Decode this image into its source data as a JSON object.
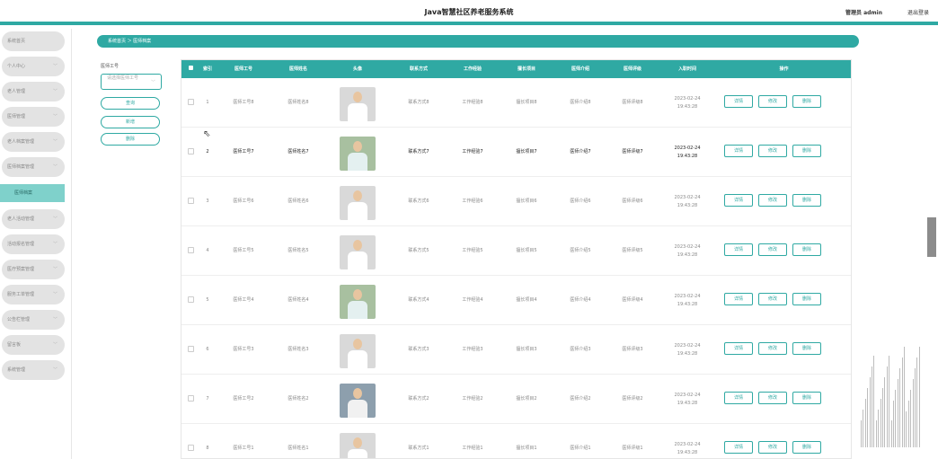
{
  "header": {
    "title": "Java智慧社区养老服务系统",
    "user": "管理员 admin",
    "logout": "退出登录"
  },
  "sidebar": {
    "items": [
      {
        "label": "系统首页",
        "has_chevron": false
      },
      {
        "label": "个人中心",
        "has_chevron": true
      },
      {
        "label": "老人管理",
        "has_chevron": true
      },
      {
        "label": "医师管理",
        "has_chevron": true
      },
      {
        "label": "老人档案管理",
        "has_chevron": true
      },
      {
        "label": "医师档案管理",
        "has_chevron": true
      },
      {
        "label": "老人活动管理",
        "has_chevron": true
      },
      {
        "label": "活动报名管理",
        "has_chevron": true
      },
      {
        "label": "医疗预案管理",
        "has_chevron": true
      },
      {
        "label": "服务工单管理",
        "has_chevron": true
      },
      {
        "label": "公告栏管理",
        "has_chevron": true
      },
      {
        "label": "留言板",
        "has_chevron": true
      },
      {
        "label": "系统管理",
        "has_chevron": true
      }
    ],
    "active_sub": "医师档案"
  },
  "breadcrumb": "系统首页 ＞ 医师档案",
  "search": {
    "label": "医师工号",
    "placeholder": "请选择医师工号",
    "query": "查询",
    "add": "新增",
    "delete": "删除"
  },
  "table": {
    "columns": [
      "",
      "索引",
      "医师工号",
      "医师姓名",
      "头像",
      "联系方式",
      "工作经验",
      "擅长项目",
      "医师介绍",
      "医师评级",
      "入职时间",
      "操作"
    ],
    "actions": [
      "详情",
      "修改",
      "删除"
    ],
    "rows": [
      {
        "index": "1",
        "no": "医师工号8",
        "name": "医师姓名8",
        "contact": "联系方式8",
        "exp": "工作经验8",
        "skill": "擅长项目8",
        "intro": "医师介绍8",
        "rate": "医师评级8",
        "date": "2023-02-24 19:43:28",
        "avatar": "v1"
      },
      {
        "index": "2",
        "no": "医师工号7",
        "name": "医师姓名7",
        "contact": "联系方式7",
        "exp": "工作经验7",
        "skill": "擅长项目7",
        "intro": "医师介绍7",
        "rate": "医师评级7",
        "date": "2023-02-24 19:43:28",
        "avatar": "v2"
      },
      {
        "index": "3",
        "no": "医师工号6",
        "name": "医师姓名6",
        "contact": "联系方式6",
        "exp": "工作经验6",
        "skill": "擅长项目6",
        "intro": "医师介绍6",
        "rate": "医师评级6",
        "date": "2023-02-24 19:43:28",
        "avatar": "v1"
      },
      {
        "index": "4",
        "no": "医师工号5",
        "name": "医师姓名5",
        "contact": "联系方式5",
        "exp": "工作经验5",
        "skill": "擅长项目5",
        "intro": "医师介绍5",
        "rate": "医师评级5",
        "date": "2023-02-24 19:43:28",
        "avatar": "v1"
      },
      {
        "index": "5",
        "no": "医师工号4",
        "name": "医师姓名4",
        "contact": "联系方式4",
        "exp": "工作经验4",
        "skill": "擅长项目4",
        "intro": "医师介绍4",
        "rate": "医师评级4",
        "date": "2023-02-24 19:43:28",
        "avatar": "v2"
      },
      {
        "index": "6",
        "no": "医师工号3",
        "name": "医师姓名3",
        "contact": "联系方式3",
        "exp": "工作经验3",
        "skill": "擅长项目3",
        "intro": "医师介绍3",
        "rate": "医师评级3",
        "date": "2023-02-24 19:43:28",
        "avatar": "v1"
      },
      {
        "index": "7",
        "no": "医师工号2",
        "name": "医师姓名2",
        "contact": "联系方式2",
        "exp": "工作经验2",
        "skill": "擅长项目2",
        "intro": "医师介绍2",
        "rate": "医师评级2",
        "date": "2023-02-24 19:43:28",
        "avatar": "v3"
      },
      {
        "index": "8",
        "no": "医师工号1",
        "name": "医师姓名1",
        "contact": "联系方式1",
        "exp": "工作经验1",
        "skill": "擅长项目1",
        "intro": "医师介绍1",
        "rate": "医师评级1",
        "date": "2023-02-24 19:43:28",
        "avatar": "v1"
      }
    ]
  },
  "colors": {
    "accent": "#2fa9a3",
    "active_sub": "#7fd1cb",
    "menu_bg": "#e3e3e3"
  }
}
